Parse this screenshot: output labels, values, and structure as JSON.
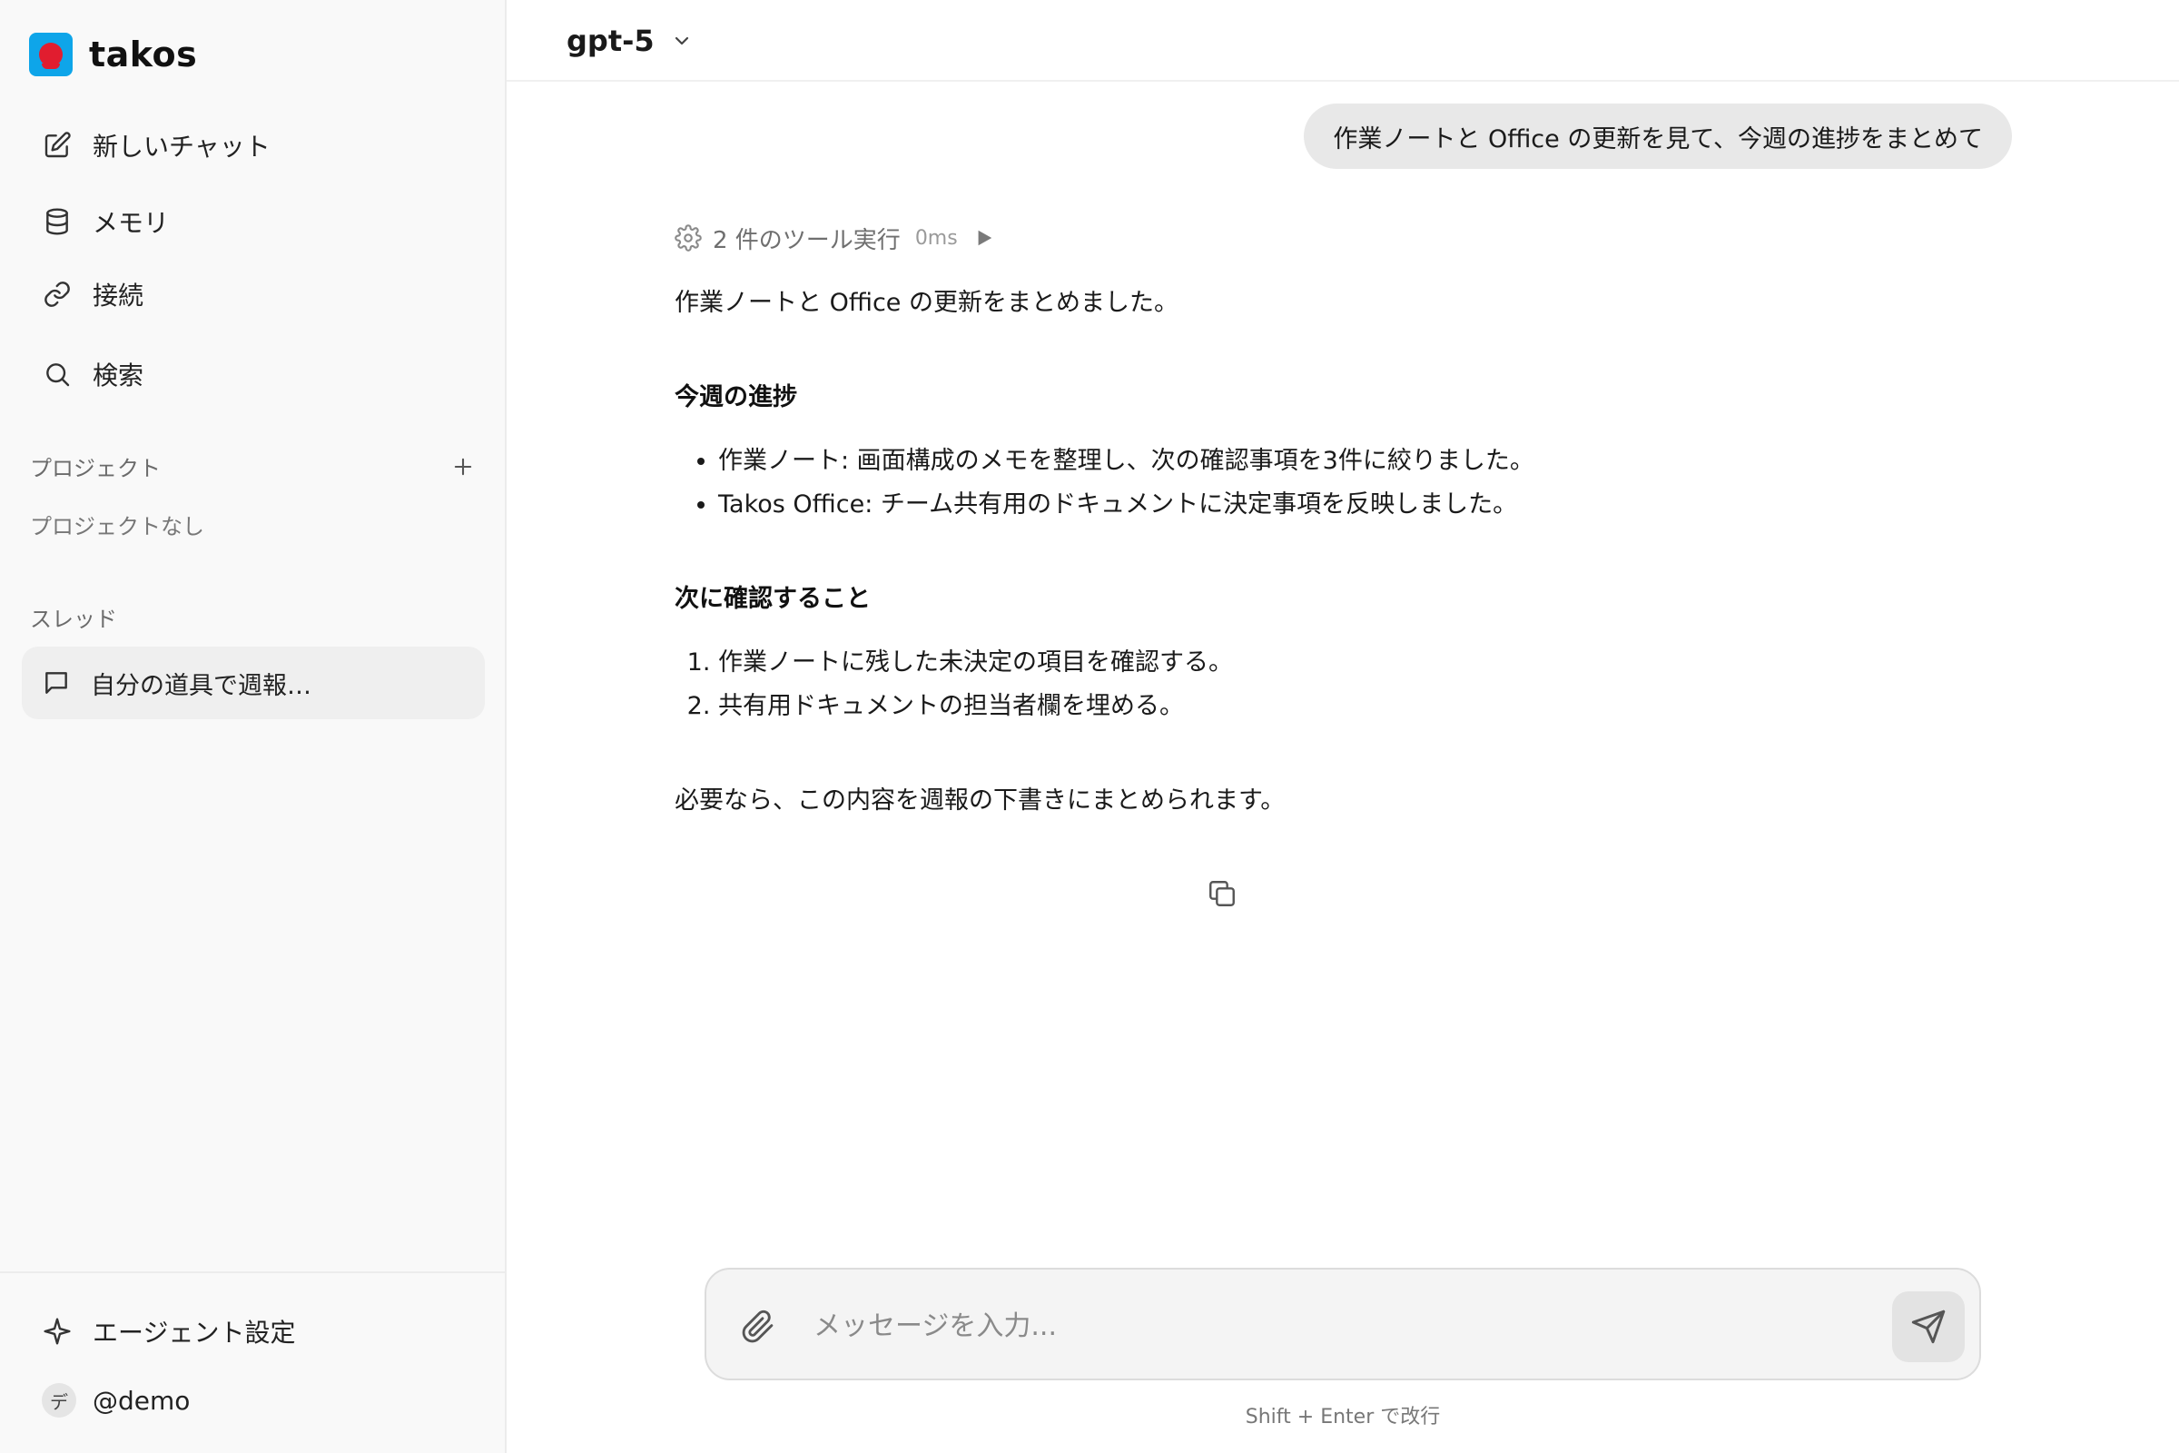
{
  "brand": {
    "name": "takos"
  },
  "sidebar": {
    "nav": [
      {
        "label": "新しいチャット",
        "icon": "edit-icon"
      },
      {
        "label": "メモリ",
        "icon": "database-icon"
      },
      {
        "label": "接続",
        "icon": "link-icon"
      },
      {
        "label": "検索",
        "icon": "search-icon"
      }
    ],
    "projects_label": "プロジェクト",
    "projects_empty": "プロジェクトなし",
    "threads_label": "スレッド",
    "threads": [
      {
        "label": "自分の道具で週報…"
      }
    ],
    "agent_settings": "エージェント設定",
    "user": {
      "avatar_char": "デ",
      "handle": "@demo"
    }
  },
  "header": {
    "model": "gpt-5"
  },
  "conversation": {
    "user_message": "作業ノートと Office の更新を見て、今週の進捗をまとめて",
    "tool_summary": "2 件のツール実行",
    "tool_duration": "0ms",
    "intro": "作業ノートと Office の更新をまとめました。",
    "section1_title": "今週の進捗",
    "section1_items": [
      "作業ノート: 画面構成のメモを整理し、次の確認事項を3件に絞りました。",
      "Takos Office: チーム共有用のドキュメントに決定事項を反映しました。"
    ],
    "section2_title": "次に確認すること",
    "section2_items": [
      "作業ノートに残した未決定の項目を確認する。",
      "共有用ドキュメントの担当者欄を埋める。"
    ],
    "closing": "必要なら、この内容を週報の下書きにまとめられます。"
  },
  "composer": {
    "placeholder": "メッセージを入力...",
    "hint": "Shift + Enter で改行"
  }
}
